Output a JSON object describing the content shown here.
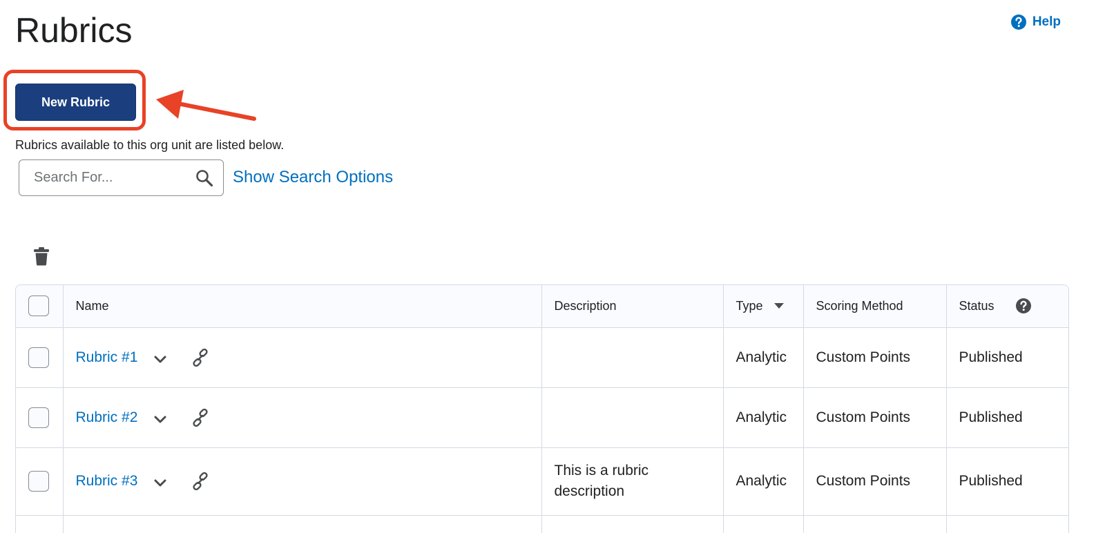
{
  "page": {
    "title": "Rubrics",
    "help_label": "Help",
    "new_rubric_label": "New Rubric",
    "intro_text": "Rubrics available to this org unit are listed below."
  },
  "search": {
    "placeholder": "Search For...",
    "value": "",
    "options_link": "Show Search Options"
  },
  "icons": {
    "help": "help-circle-icon",
    "search": "search-icon",
    "delete": "trash-icon",
    "expand": "chevron-down-icon",
    "copy_link": "link-icon",
    "sort": "sort-down-icon",
    "status_help": "help-circle-icon"
  },
  "colors": {
    "accent_link": "#006fbf",
    "primary_button": "#1b3f7e",
    "annotation": "#e84227"
  },
  "table": {
    "headers": {
      "name": "Name",
      "description": "Description",
      "type": "Type",
      "scoring": "Scoring Method",
      "status": "Status"
    },
    "rows": [
      {
        "name": "Rubric #1",
        "description": "",
        "type": "Analytic",
        "scoring": "Custom Points",
        "status": "Published"
      },
      {
        "name": "Rubric #2",
        "description": "",
        "type": "Analytic",
        "scoring": "Custom Points",
        "status": "Published"
      },
      {
        "name": "Rubric #3",
        "description": "This is a rubric description",
        "type": "Analytic",
        "scoring": "Custom Points",
        "status": "Published"
      },
      {
        "name": "",
        "description": "",
        "type": "",
        "scoring": "",
        "status": ""
      }
    ]
  }
}
